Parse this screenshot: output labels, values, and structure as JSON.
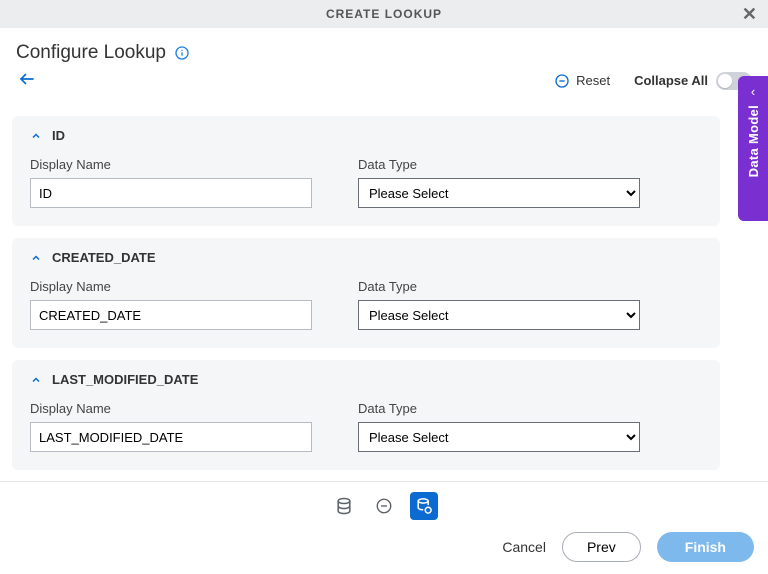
{
  "titlebar": {
    "title": "CREATE LOOKUP"
  },
  "header": {
    "title": "Configure Lookup"
  },
  "actions": {
    "reset": "Reset",
    "collapse_all": "Collapse All"
  },
  "side_tab": {
    "label": "Data Model"
  },
  "labels": {
    "display_name": "Display Name",
    "data_type": "Data Type",
    "select_placeholder": "Please Select"
  },
  "panels": [
    {
      "title": "ID",
      "display_name": "ID"
    },
    {
      "title": "CREATED_DATE",
      "display_name": "CREATED_DATE"
    },
    {
      "title": "LAST_MODIFIED_DATE",
      "display_name": "LAST_MODIFIED_DATE"
    }
  ],
  "footer": {
    "cancel": "Cancel",
    "prev": "Prev",
    "finish": "Finish"
  }
}
